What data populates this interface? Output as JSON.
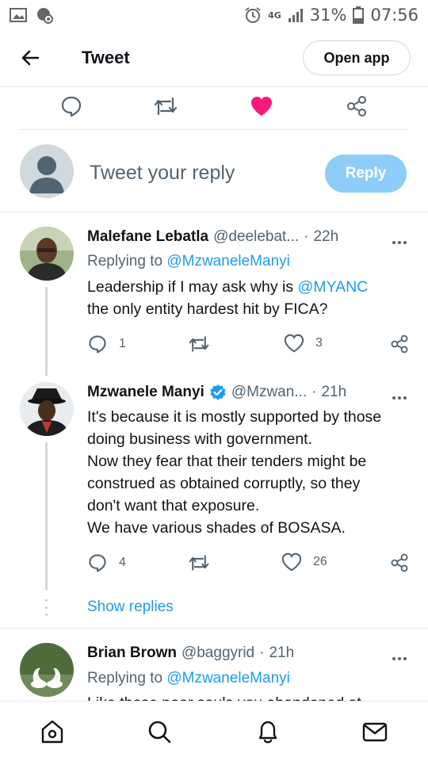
{
  "status_bar": {
    "network": "4G",
    "battery": "31%",
    "time": "07:56"
  },
  "header": {
    "title": "Tweet",
    "open_app_label": "Open app"
  },
  "composer": {
    "placeholder": "Tweet your reply",
    "reply_label": "Reply"
  },
  "tweets": [
    {
      "name": "Malefane Lebatla",
      "handle": "@deelebat...",
      "dot": "·",
      "time": "22h",
      "replying_prefix": "Replying to",
      "replying_to": "@MzwaneleManyi",
      "body_pre": "Leadership if I may ask why is ",
      "body_mention": "@MYANC",
      "body_post": " the only entity hardest hit by FICA?",
      "reply_count": "1",
      "retweet_count": "",
      "like_count": "3"
    },
    {
      "name": "Mzwanele Manyi",
      "handle": "@Mzwan...",
      "dot": "·",
      "time": "21h",
      "verified": true,
      "body_lines": [
        "It's because it is mostly supported by those",
        "doing business with government.",
        "Now they fear that their tenders might be",
        "construed as obtained corruptly, so they",
        "don't want that exposure.",
        "We have various shades of BOSASA."
      ],
      "reply_count": "4",
      "retweet_count": "",
      "like_count": "26",
      "show_replies": "Show replies"
    },
    {
      "name": "Brian Brown",
      "handle": "@baggyrid",
      "dot": "·",
      "time": "21h",
      "replying_prefix": "Replying to",
      "replying_to": "@MzwaneleManyi",
      "body_partial": "Like those poor souls you abandoned at"
    }
  ],
  "bottom_nav": [
    "home-icon",
    "search-icon",
    "notifications-icon",
    "messages-icon"
  ],
  "colors": {
    "accent": "#1d9bf0",
    "like": "#f91880",
    "reply_button": "#8ecdf8",
    "muted": "#536471"
  }
}
